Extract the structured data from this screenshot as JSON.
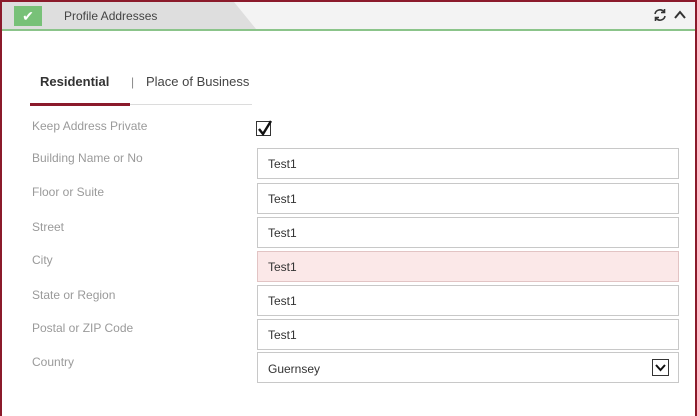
{
  "panel": {
    "title": "Profile Addresses",
    "status": "complete",
    "accent_color": "#8b1a2b",
    "check_color": "#78c178"
  },
  "tabs": {
    "residential": "Residential",
    "separator": "|",
    "business": "Place of Business",
    "active": "Residential"
  },
  "form": {
    "keep_private": {
      "label": "Keep Address Private",
      "checked": true
    },
    "building": {
      "label": "Building Name or No",
      "value": "Test1"
    },
    "floor": {
      "label": "Floor or Suite",
      "value": "Test1"
    },
    "street": {
      "label": "Street",
      "value": "Test1"
    },
    "city": {
      "label": "City",
      "value": "Test1",
      "state": "error"
    },
    "state": {
      "label": "State or Region",
      "value": "Test1"
    },
    "postal": {
      "label": "Postal or ZIP Code",
      "value": "Test1"
    },
    "country": {
      "label": "Country",
      "value": "Guernsey"
    }
  }
}
